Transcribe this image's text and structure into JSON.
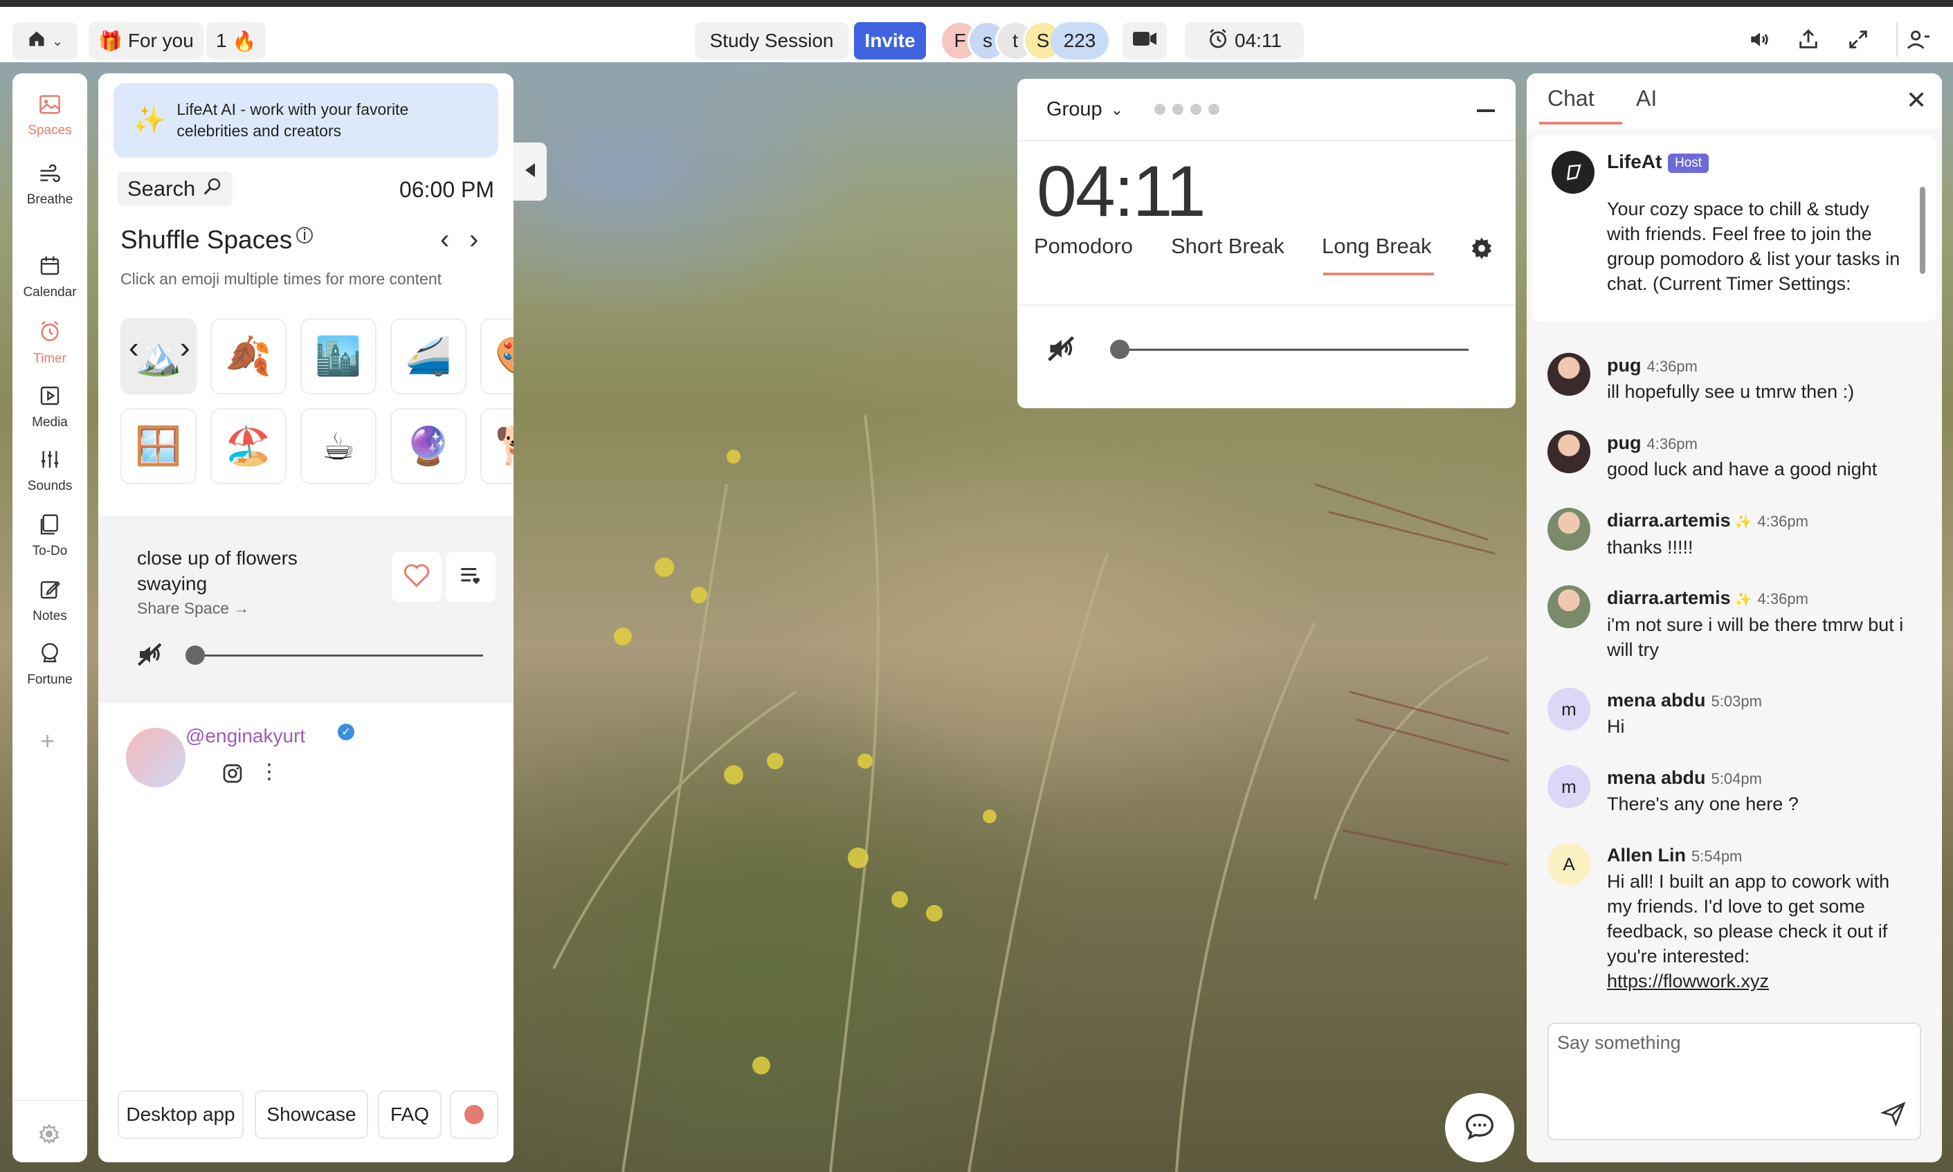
{
  "topbar": {
    "home_label": "",
    "for_you": "For you",
    "streak": "1",
    "streak_emoji": "🔥",
    "gift_emoji": "🎁",
    "session": "Study Session",
    "invite": "Invite",
    "participants": [
      {
        "letter": "F",
        "color": "#f4c8c0"
      },
      {
        "letter": "s",
        "color": "#c7d7f5"
      },
      {
        "letter": "t",
        "color": "#e7e7e7"
      },
      {
        "letter": "S",
        "color": "#f9eaa5"
      }
    ],
    "participant_count": "223",
    "timer": "04:11"
  },
  "sidebar": {
    "items": [
      {
        "label": "Spaces",
        "icon": "image-icon",
        "active": true
      },
      {
        "label": "Breathe",
        "icon": "wind-icon"
      },
      {
        "label": "Calendar",
        "icon": "calendar-icon"
      },
      {
        "label": "Timer",
        "icon": "alarm-clock-icon",
        "active": true
      },
      {
        "label": "Media",
        "icon": "media-icon"
      },
      {
        "label": "Sounds",
        "icon": "sliders-icon"
      },
      {
        "label": "To-Do",
        "icon": "todo-icon"
      },
      {
        "label": "Notes",
        "icon": "notes-icon"
      },
      {
        "label": "Fortune",
        "icon": "crystal-ball-icon"
      }
    ]
  },
  "panel": {
    "ai_banner": "LifeAt AI - work with your favorite celebrities and creators",
    "search": "Search",
    "time": "06:00 PM",
    "shuffle_title": "Shuffle Spaces",
    "hint": "Click an emoji multiple times for more content",
    "emojis_row1": [
      "🏔️",
      "🍂",
      "🏙️",
      "🚄",
      "🎨"
    ],
    "emojis_row2": [
      "🪟",
      "🏖️",
      "☕",
      "🔮",
      "🐕"
    ],
    "space_title": "close up of flowers swaying",
    "share": "Share Space →",
    "creator_handle": "@enginakyurt",
    "footer": [
      "Desktop app",
      "Showcase",
      "FAQ"
    ]
  },
  "timer_card": {
    "mode": "Group",
    "time": "04:11",
    "tabs": [
      "Pomodoro",
      "Short Break",
      "Long Break"
    ],
    "active_tab": "Long Break"
  },
  "chat": {
    "tabs": [
      "Chat",
      "AI"
    ],
    "host_name": "LifeAt",
    "host_badge": "Host",
    "host_message": "Your cozy space to chill & study with friends. Feel free to join the group pomodoro & list your tasks in chat. (Current Timer Settings:",
    "messages": [
      {
        "name": "pug",
        "time": "4:36pm",
        "text": "ill hopefully see u tmrw then :)",
        "avatar": "",
        "color": "#3a2a2a"
      },
      {
        "name": "pug",
        "time": "4:36pm",
        "text": "good luck and have a good night",
        "avatar": "",
        "color": "#3a2a2a"
      },
      {
        "name": "diarra.artemis",
        "time": "4:36pm",
        "text": "thanks !!!!!",
        "avatar": "",
        "color": "#7a8a6a",
        "sparkle": "✨"
      },
      {
        "name": "diarra.artemis",
        "time": "4:36pm",
        "text": "i'm not sure i will be there tmrw but i will try",
        "avatar": "",
        "color": "#7a8a6a",
        "sparkle": "✨"
      },
      {
        "name": "mena abdu",
        "time": "5:03pm",
        "text": "Hi",
        "avatar": "m",
        "color": "#dcd6f7"
      },
      {
        "name": "mena abdu",
        "time": "5:04pm",
        "text": "There's any one here ?",
        "avatar": "m",
        "color": "#dcd6f7"
      },
      {
        "name": "Allen Lin",
        "time": "5:54pm",
        "text": "Hi all! I built an app to cowork with my friends. I'd love to get some feedback, so please check it out if you're interested:",
        "link": "https://flowwork.xyz",
        "avatar": "A",
        "color": "#fbf2c4"
      }
    ],
    "input_placeholder": "Say something"
  }
}
